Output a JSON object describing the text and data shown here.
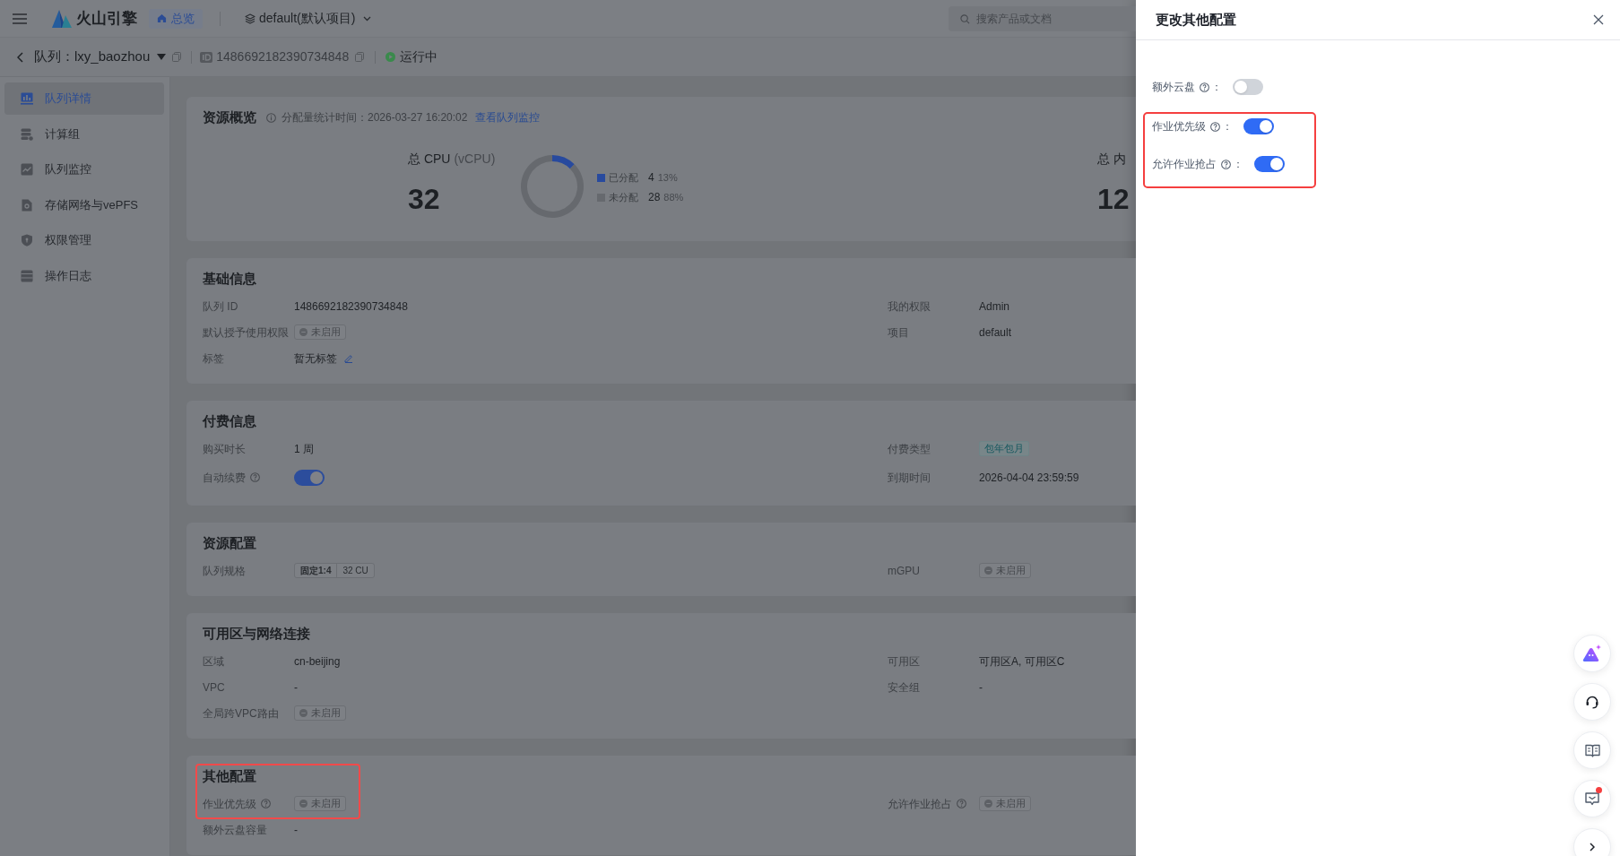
{
  "top_bar": {
    "logo": "火山引擎",
    "home": "总览",
    "project": "default(默认项目)",
    "search": {
      "placeholder": "搜索产品或文档"
    }
  },
  "header": {
    "title": "队列：lxy_baozhou",
    "id": "1486692182390734848",
    "status": "运行中"
  },
  "sidebar": {
    "items": [
      {
        "label": "队列详情",
        "selected": true
      },
      {
        "label": "计算组",
        "selected": false
      },
      {
        "label": "队列监控",
        "selected": false
      },
      {
        "label": "存储网络与vePFS",
        "selected": false
      },
      {
        "label": "权限管理",
        "selected": false
      },
      {
        "label": "操作日志",
        "selected": false
      }
    ]
  },
  "overview": {
    "title": "资源概览",
    "stat_time": "分配量统计时间：2026-03-27 16:20:02",
    "link": "查看队列监控",
    "cpu": {
      "label": "总 CPU",
      "unit": "(vCPU)",
      "total": "32",
      "chart_data": {
        "type": "donut",
        "categories": [
          "已分配",
          "未分配"
        ],
        "values": [
          12.5,
          87.5
        ],
        "legend": "right"
      },
      "legend": [
        {
          "value": "4",
          "percent": "13%",
          "color": "#284a9e"
        },
        {
          "value": "28",
          "percent": "88%",
          "color": "#66696e"
        }
      ]
    },
    "memory": {
      "label": "总 内",
      "total": "12"
    }
  },
  "sections": [
    {
      "title": "基础信息",
      "highlighted": false,
      "rows": [
        [
          {
            "label": "队列 ID",
            "kind": "text",
            "value": "1486692182390734848"
          },
          {
            "label": "我的权限",
            "kind": "text",
            "value": "Admin"
          }
        ],
        [
          {
            "label": "默认授予使用权限",
            "kind": "status",
            "value": "未启用"
          },
          {
            "label": "项目",
            "kind": "text",
            "value": "default"
          }
        ],
        [
          {
            "label": "标签",
            "kind": "editable",
            "value": "暂无标签"
          }
        ]
      ]
    },
    {
      "title": "付费信息",
      "highlighted": false,
      "rows": [
        [
          {
            "label": "购买时长",
            "kind": "text",
            "value": "1 周"
          },
          {
            "label": "付费类型",
            "kind": "badge",
            "value": "包年包月"
          }
        ],
        [
          {
            "label": "自动续费",
            "help": true,
            "kind": "toggle",
            "on": true
          },
          {
            "label": "到期时间",
            "kind": "text",
            "value": "2026-04-04 23:59:59"
          }
        ]
      ]
    },
    {
      "title": "资源配置",
      "highlighted": false,
      "rows": [
        [
          {
            "label": "队列规格",
            "kind": "spec",
            "segments": [
              "固定1:4",
              "32 CU"
            ]
          },
          {
            "label": "mGPU",
            "kind": "status",
            "value": "未启用"
          }
        ]
      ]
    },
    {
      "title": "可用区与网络连接",
      "highlighted": false,
      "rows": [
        [
          {
            "label": "区域",
            "kind": "text",
            "value": "cn-beijing"
          },
          {
            "label": "可用区",
            "kind": "text",
            "value": "可用区A, 可用区C"
          }
        ],
        [
          {
            "label": "VPC",
            "kind": "text",
            "value": "-"
          },
          {
            "label": "安全组",
            "kind": "text",
            "value": "-"
          }
        ],
        [
          {
            "label": "全局跨VPC路由",
            "kind": "status",
            "value": "未启用"
          }
        ]
      ]
    },
    {
      "title": "其他配置",
      "highlighted": true,
      "rows": [
        [
          {
            "label": "作业优先级",
            "help": true,
            "kind": "status",
            "value": "未启用"
          },
          {
            "label": "允许作业抢占",
            "help": true,
            "kind": "status",
            "value": "未启用"
          }
        ],
        [
          {
            "label": "额外云盘容量",
            "kind": "text",
            "value": "-"
          }
        ]
      ]
    }
  ],
  "drawer": {
    "title": "更改其他配置",
    "fields": [
      {
        "label": "额外云盘",
        "help": true,
        "suffix": "：",
        "on": false,
        "highlighted": false
      },
      {
        "label": "作业优先级",
        "help": true,
        "suffix": "：",
        "on": true,
        "highlighted": true
      },
      {
        "label": "允许作业抢占",
        "help": true,
        "suffix": "：",
        "on": true,
        "highlighted": true
      }
    ]
  }
}
